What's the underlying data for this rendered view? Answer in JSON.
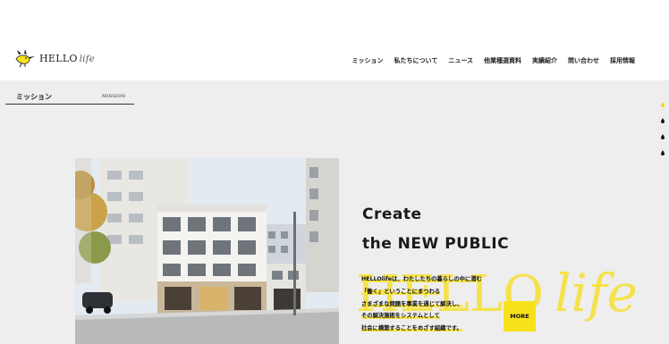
{
  "header": {
    "logo": {
      "word": "HELLO",
      "script": "life"
    },
    "nav": [
      "ミッション",
      "私たちについて",
      "ニュース",
      "他業種選資料",
      "実績紹介",
      "問い合わせ",
      "採用情報"
    ]
  },
  "crumb": {
    "ja": "ミッション",
    "en": "MISSION"
  },
  "hero": {
    "headline_1": "Create",
    "headline_2": "the NEW PUBLIC",
    "watermark_word": "HELLO",
    "watermark_script": "life",
    "lines": [
      "HELLOlifeは、わたしたちの暮らしの中に潜む",
      "「働く」ということにまつわる",
      "さまざまな問題を事業を通じて解決し、",
      "その解決施術をシステムとして",
      "社会に横築することをめざす組織です。"
    ],
    "more_label": "MORE"
  },
  "colors": {
    "accent_yellow": "#f7e21a",
    "dot_active": "#f2d718",
    "dot_inactive": "#111111",
    "background_gray": "#eeeeee"
  },
  "pagination": {
    "count": 4,
    "active_index": 0
  },
  "icons": {
    "logo": "bird-icon",
    "dots": "drop-icon"
  }
}
